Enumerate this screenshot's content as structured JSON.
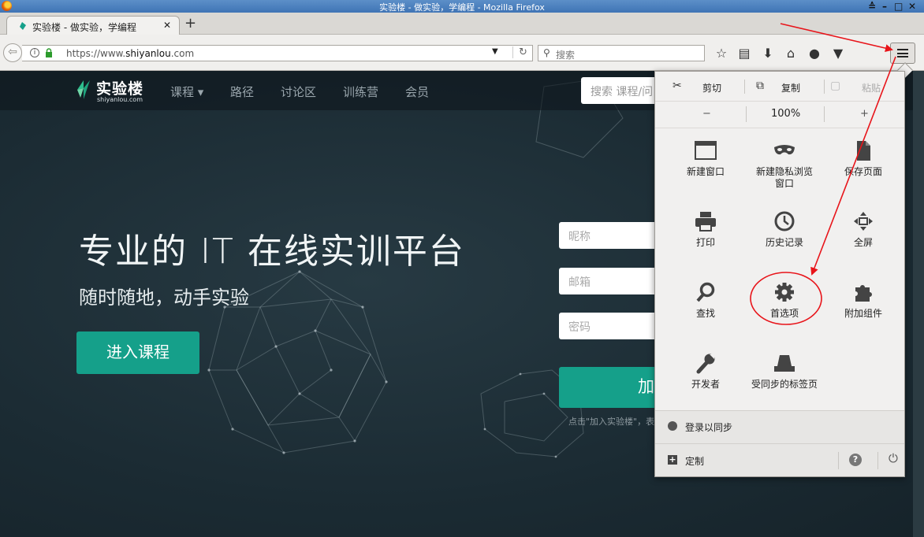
{
  "window": {
    "title": "实验楼 - 做实验，学编程 - Mozilla Firefox",
    "controls": [
      "≙",
      "–",
      "□",
      "✕"
    ]
  },
  "tabbar": {
    "tab_title": "实验楼 - 做实验，学编程",
    "close_label": "✕",
    "new_tab_label": "+"
  },
  "navbar": {
    "url_prefix": "https://www.",
    "url_domain": "shiyanlou",
    "url_suffix": ".com",
    "search_placeholder": "搜索"
  },
  "site": {
    "logo_text": "实验楼",
    "logo_domain": "shiyanlou.com",
    "nav": [
      "课程 ▾",
      "路径",
      "讨论区",
      "训练营",
      "会员"
    ],
    "search_placeholder": "搜索 课程/问"
  },
  "hero": {
    "title": "专业的 IT 在线实训平台",
    "subtitle": "随时随地，动手实验",
    "cta": "进入课程"
  },
  "register": {
    "nickname_placeholder": "昵称",
    "email_placeholder": "邮箱",
    "password_placeholder": "密码",
    "submit_label": "加",
    "note": "点击\"加入实验楼\"，表"
  },
  "menu_panel": {
    "edit": {
      "cut": "剪切",
      "copy": "复制",
      "paste": "粘贴"
    },
    "zoom": {
      "minus": "−",
      "level": "100%",
      "plus": "+"
    },
    "items": [
      {
        "label": "新建窗口",
        "icon": "new-window-icon"
      },
      {
        "label": "新建隐私浏览窗口",
        "icon": "private-mask-icon"
      },
      {
        "label": "保存页面",
        "icon": "save-page-icon"
      },
      {
        "label": "打印",
        "icon": "printer-icon"
      },
      {
        "label": "历史记录",
        "icon": "history-clock-icon"
      },
      {
        "label": "全屏",
        "icon": "fullscreen-icon"
      },
      {
        "label": "查找",
        "icon": "find-magnifier-icon"
      },
      {
        "label": "首选项",
        "icon": "preferences-gear-icon"
      },
      {
        "label": "附加组件",
        "icon": "addons-puzzle-icon"
      },
      {
        "label": "开发者",
        "icon": "developer-wrench-icon"
      },
      {
        "label": "受同步的标签页",
        "icon": "synced-tabs-icon"
      }
    ],
    "sync_label": "登录以同步",
    "customize_label": "定制"
  },
  "annotation": {
    "color": "#e8141a"
  }
}
